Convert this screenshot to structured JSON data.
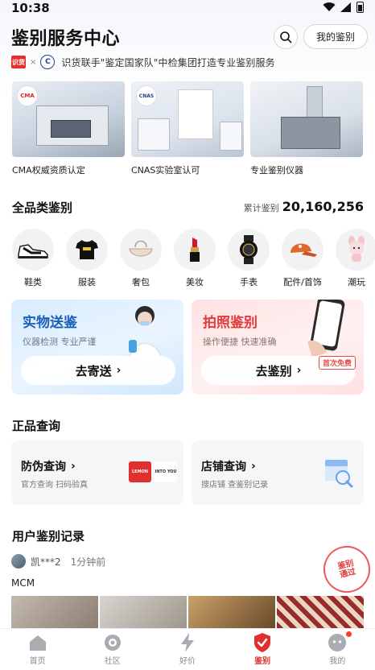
{
  "status_bar": {
    "time": "10:38"
  },
  "header": {
    "title": "鉴别服务中心",
    "my_appraisal_label": "我的鉴别"
  },
  "partner": {
    "logo_left": "识货",
    "logo_sep": "×",
    "text": "识货联手\"鉴定国家队\"中检集团打造专业鉴别服务"
  },
  "certs": [
    {
      "caption": "CMA权威资质认定",
      "badge": "CMA"
    },
    {
      "caption": "CNAS实验室认可",
      "badge": "CNAS"
    },
    {
      "caption": "专业鉴别仪器"
    }
  ],
  "categories": {
    "title": "全品类鉴别",
    "total_label": "累计鉴别",
    "total_value": "20,160,256",
    "items": [
      {
        "label": "鞋类",
        "icon": "sneaker-icon"
      },
      {
        "label": "服装",
        "icon": "tshirt-icon"
      },
      {
        "label": "奢包",
        "icon": "handbag-icon"
      },
      {
        "label": "美妆",
        "icon": "lipstick-icon"
      },
      {
        "label": "手表",
        "icon": "watch-icon"
      },
      {
        "label": "配件/首饰",
        "icon": "cap-icon"
      },
      {
        "label": "潮玩",
        "icon": "toy-icon"
      }
    ]
  },
  "services": {
    "physical": {
      "title": "实物送鉴",
      "subtitle": "仪器检测 专业严谨",
      "button": "去寄送"
    },
    "photo": {
      "title": "拍照鉴别",
      "subtitle": "操作便捷 快速准确",
      "button": "去鉴别",
      "tag": "首次免费"
    }
  },
  "query": {
    "title": "正品查询",
    "anti_fake": {
      "title": "防伪查询",
      "subtitle": "官方查询 扫码验真",
      "logos": [
        "LEMON",
        "INTO YOU"
      ]
    },
    "store": {
      "title": "店铺查询",
      "subtitle": "搜店铺 查鉴别记录"
    }
  },
  "records": {
    "title": "用户鉴别记录",
    "user": "凯***2",
    "time": "1分钟前",
    "brand": "MCM",
    "stamp": "鉴别\n通过"
  },
  "tabbar": [
    {
      "label": "首页",
      "icon": "home-icon",
      "active": false
    },
    {
      "label": "社区",
      "icon": "community-icon",
      "active": false
    },
    {
      "label": "好价",
      "icon": "lightning-icon",
      "active": false
    },
    {
      "label": "鉴别",
      "icon": "shield-check-icon",
      "active": true
    },
    {
      "label": "我的",
      "icon": "profile-icon",
      "active": false
    }
  ],
  "colors": {
    "accent_red": "#e02f2f",
    "accent_blue": "#1b5fb8",
    "text_dark": "#111111"
  }
}
